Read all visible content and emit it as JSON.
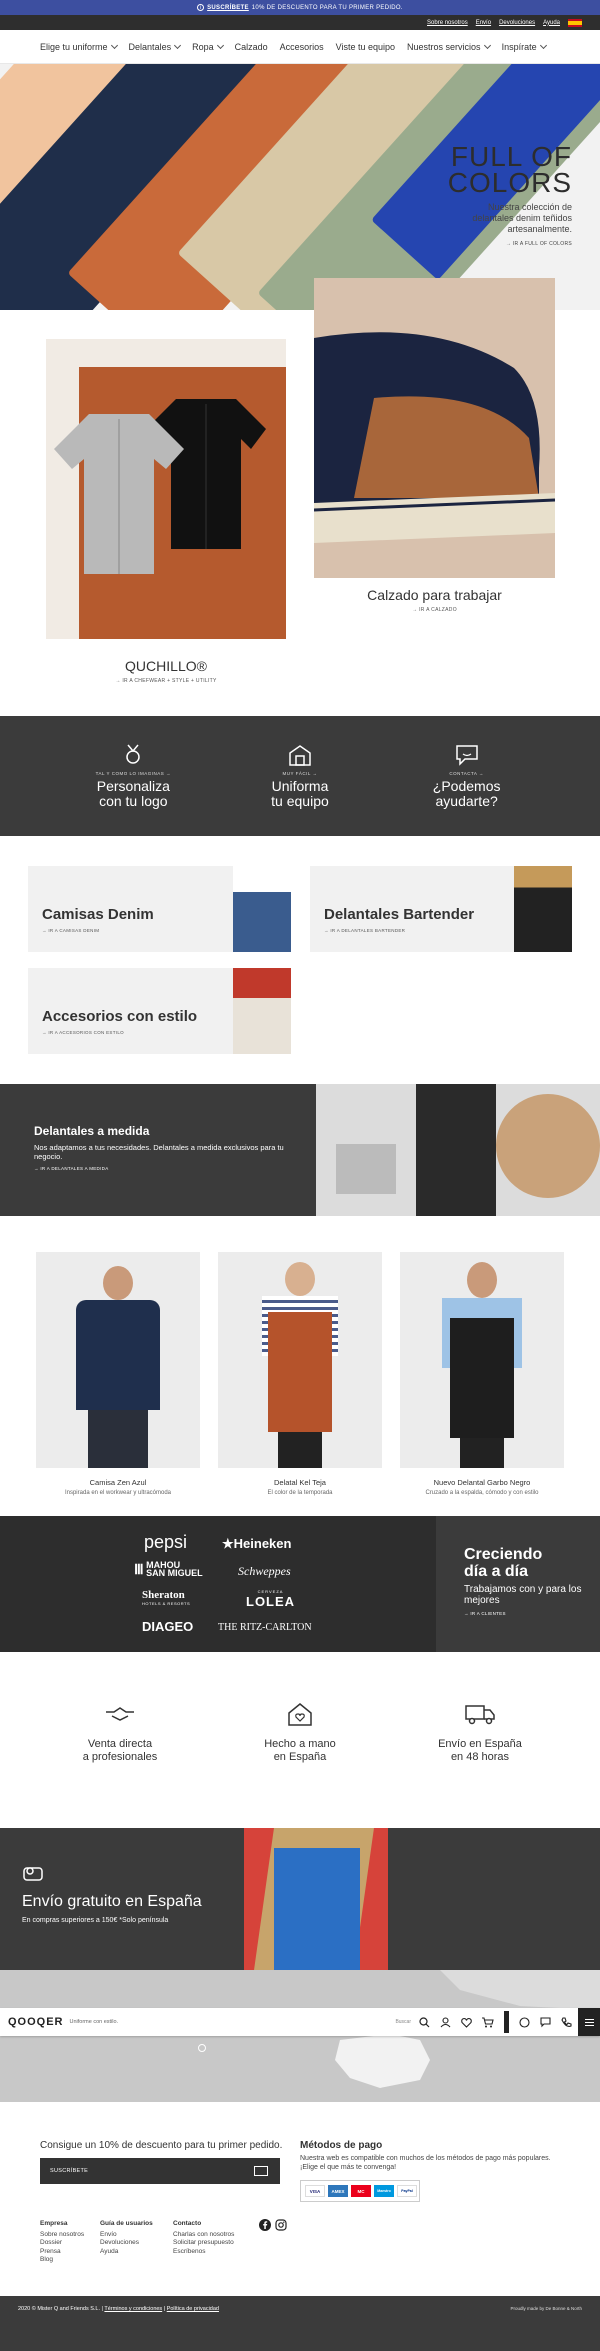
{
  "promo": {
    "link": "SUSCRÍBETE",
    "text": "10% DE DESCUENTO PARA TU PRIMER PEDIDO."
  },
  "toplinks": [
    "Sobre nosotros",
    "Envío",
    "Devoluciones",
    "Ayuda"
  ],
  "nav": [
    {
      "label": "Elige tu uniforme",
      "has_menu": true
    },
    {
      "label": "Delantales",
      "has_menu": true
    },
    {
      "label": "Ropa",
      "has_menu": true
    },
    {
      "label": "Calzado",
      "has_menu": false
    },
    {
      "label": "Accesorios",
      "has_menu": false
    },
    {
      "label": "Viste tu equipo",
      "has_menu": false
    },
    {
      "label": "Nuestros servicios",
      "has_menu": true
    },
    {
      "label": "Inspírate",
      "has_menu": true
    }
  ],
  "hero": {
    "title_line1": "FULL OF",
    "title_line2": "COLORS",
    "subtitle": "Nuestra colección de delantales denim teñidos artesanalmente.",
    "cta": "IR A FULL OF COLORS"
  },
  "duo": {
    "left_title": "QUCHILLO®",
    "left_cta": "IR A CHEFWEAR + STYLE + UTILITY",
    "right_title": "Calzado para trabajar",
    "right_cta": "IR A CALZADO"
  },
  "features": [
    {
      "kicker": "TAL Y COMO LO IMAGINAS",
      "line1": "Personaliza",
      "line2": "con tu logo"
    },
    {
      "kicker": "MUY FÁCIL",
      "line1": "Uniforma",
      "line2": "tu equipo"
    },
    {
      "kicker": "CONTACTA",
      "line1": "¿Podemos",
      "line2": "ayudarte?"
    }
  ],
  "categories": [
    {
      "title": "Camisas Denim",
      "cta": "IR A CAMISAS DENIM"
    },
    {
      "title": "Delantales Bartender",
      "cta": "IR A DELANTALES BARTENDER"
    },
    {
      "title": "Accesorios con estilo",
      "cta": "IR A ACCESORIOS CON ESTILO"
    }
  ],
  "custom": {
    "title": "Delantales a medida",
    "text": "Nos adaptamos a tus necesidades. Delantales a medida exclusivos para tu negocio.",
    "cta": "IR A DELANTALES A MEDIDA"
  },
  "products": [
    {
      "name": "Camisa Zen Azul",
      "desc": "Inspirada en el workwear y ultracómoda"
    },
    {
      "name": "Delatal Kel Teja",
      "desc": "El color de la temporada"
    },
    {
      "name": "Nuevo Delantal Garbo Negro",
      "desc": "Cruzado a la espalda, cómodo y con estilo"
    }
  ],
  "clients": {
    "logos": [
      "pepsi",
      "★Heineken",
      "MAHOU",
      "SAN MIGUEL",
      "Schweppes",
      "Sheraton",
      "HOTELS & RESORTS",
      "CERVEZA",
      "LOLEA",
      "DIAGEO",
      "THE RITZ-CARLTON"
    ],
    "title_line1": "Creciendo",
    "title_line2": "día a día",
    "text": "Trabajamos con y para los mejores",
    "cta": "IR A CLIENTES"
  },
  "benefits": [
    {
      "line1": "Venta directa",
      "line2": "a profesionales"
    },
    {
      "line1": "Hecho a mano",
      "line2": "en España"
    },
    {
      "line1": "Envío en España",
      "line2": "en 48 horas"
    }
  ],
  "shipping": {
    "title": "Envío gratuito en España",
    "text": "En compras superiores a 150€ *Solo península"
  },
  "sitebar": {
    "brand": "QOOQER",
    "slogan": "Uniforme con estilo.",
    "search": "Buscar"
  },
  "footer": {
    "newsletter_title": "Consigue un 10% de descuento para tu primer pedido.",
    "newsletter_placeholder": "SUSCRÍBETE",
    "pay_title": "Métodos de pago",
    "pay_text": "Nuestra web es compatible con muchos de los métodos de pago más populares. ¡Elige el que más te convenga!",
    "cards": [
      "VISA",
      "AMEX",
      "MC",
      "Maestro",
      "PayPal"
    ],
    "col1": {
      "title": "Empresa",
      "links": [
        "Sobre nosotros",
        "Dossier",
        "Prensa",
        "Blog"
      ]
    },
    "col2": {
      "title": "Guía de usuarios",
      "links": [
        "Envío",
        "Devoluciones",
        "Ayuda"
      ]
    },
    "col3": {
      "title": "Contacto",
      "links": [
        "Charlas con nosotros",
        "Solicitar presupuesto",
        "Escríbenos"
      ]
    },
    "copyright": "2020 © Mister Q and Friends S.L.",
    "terms": "Términos y condiciones",
    "privacy": "Política de privacidad",
    "credit": "Proudly made by De Bonne & North"
  },
  "colors": {
    "promo": "#3d4fa0",
    "dark": "#3b3b3b",
    "teja": "#b55a2e"
  }
}
